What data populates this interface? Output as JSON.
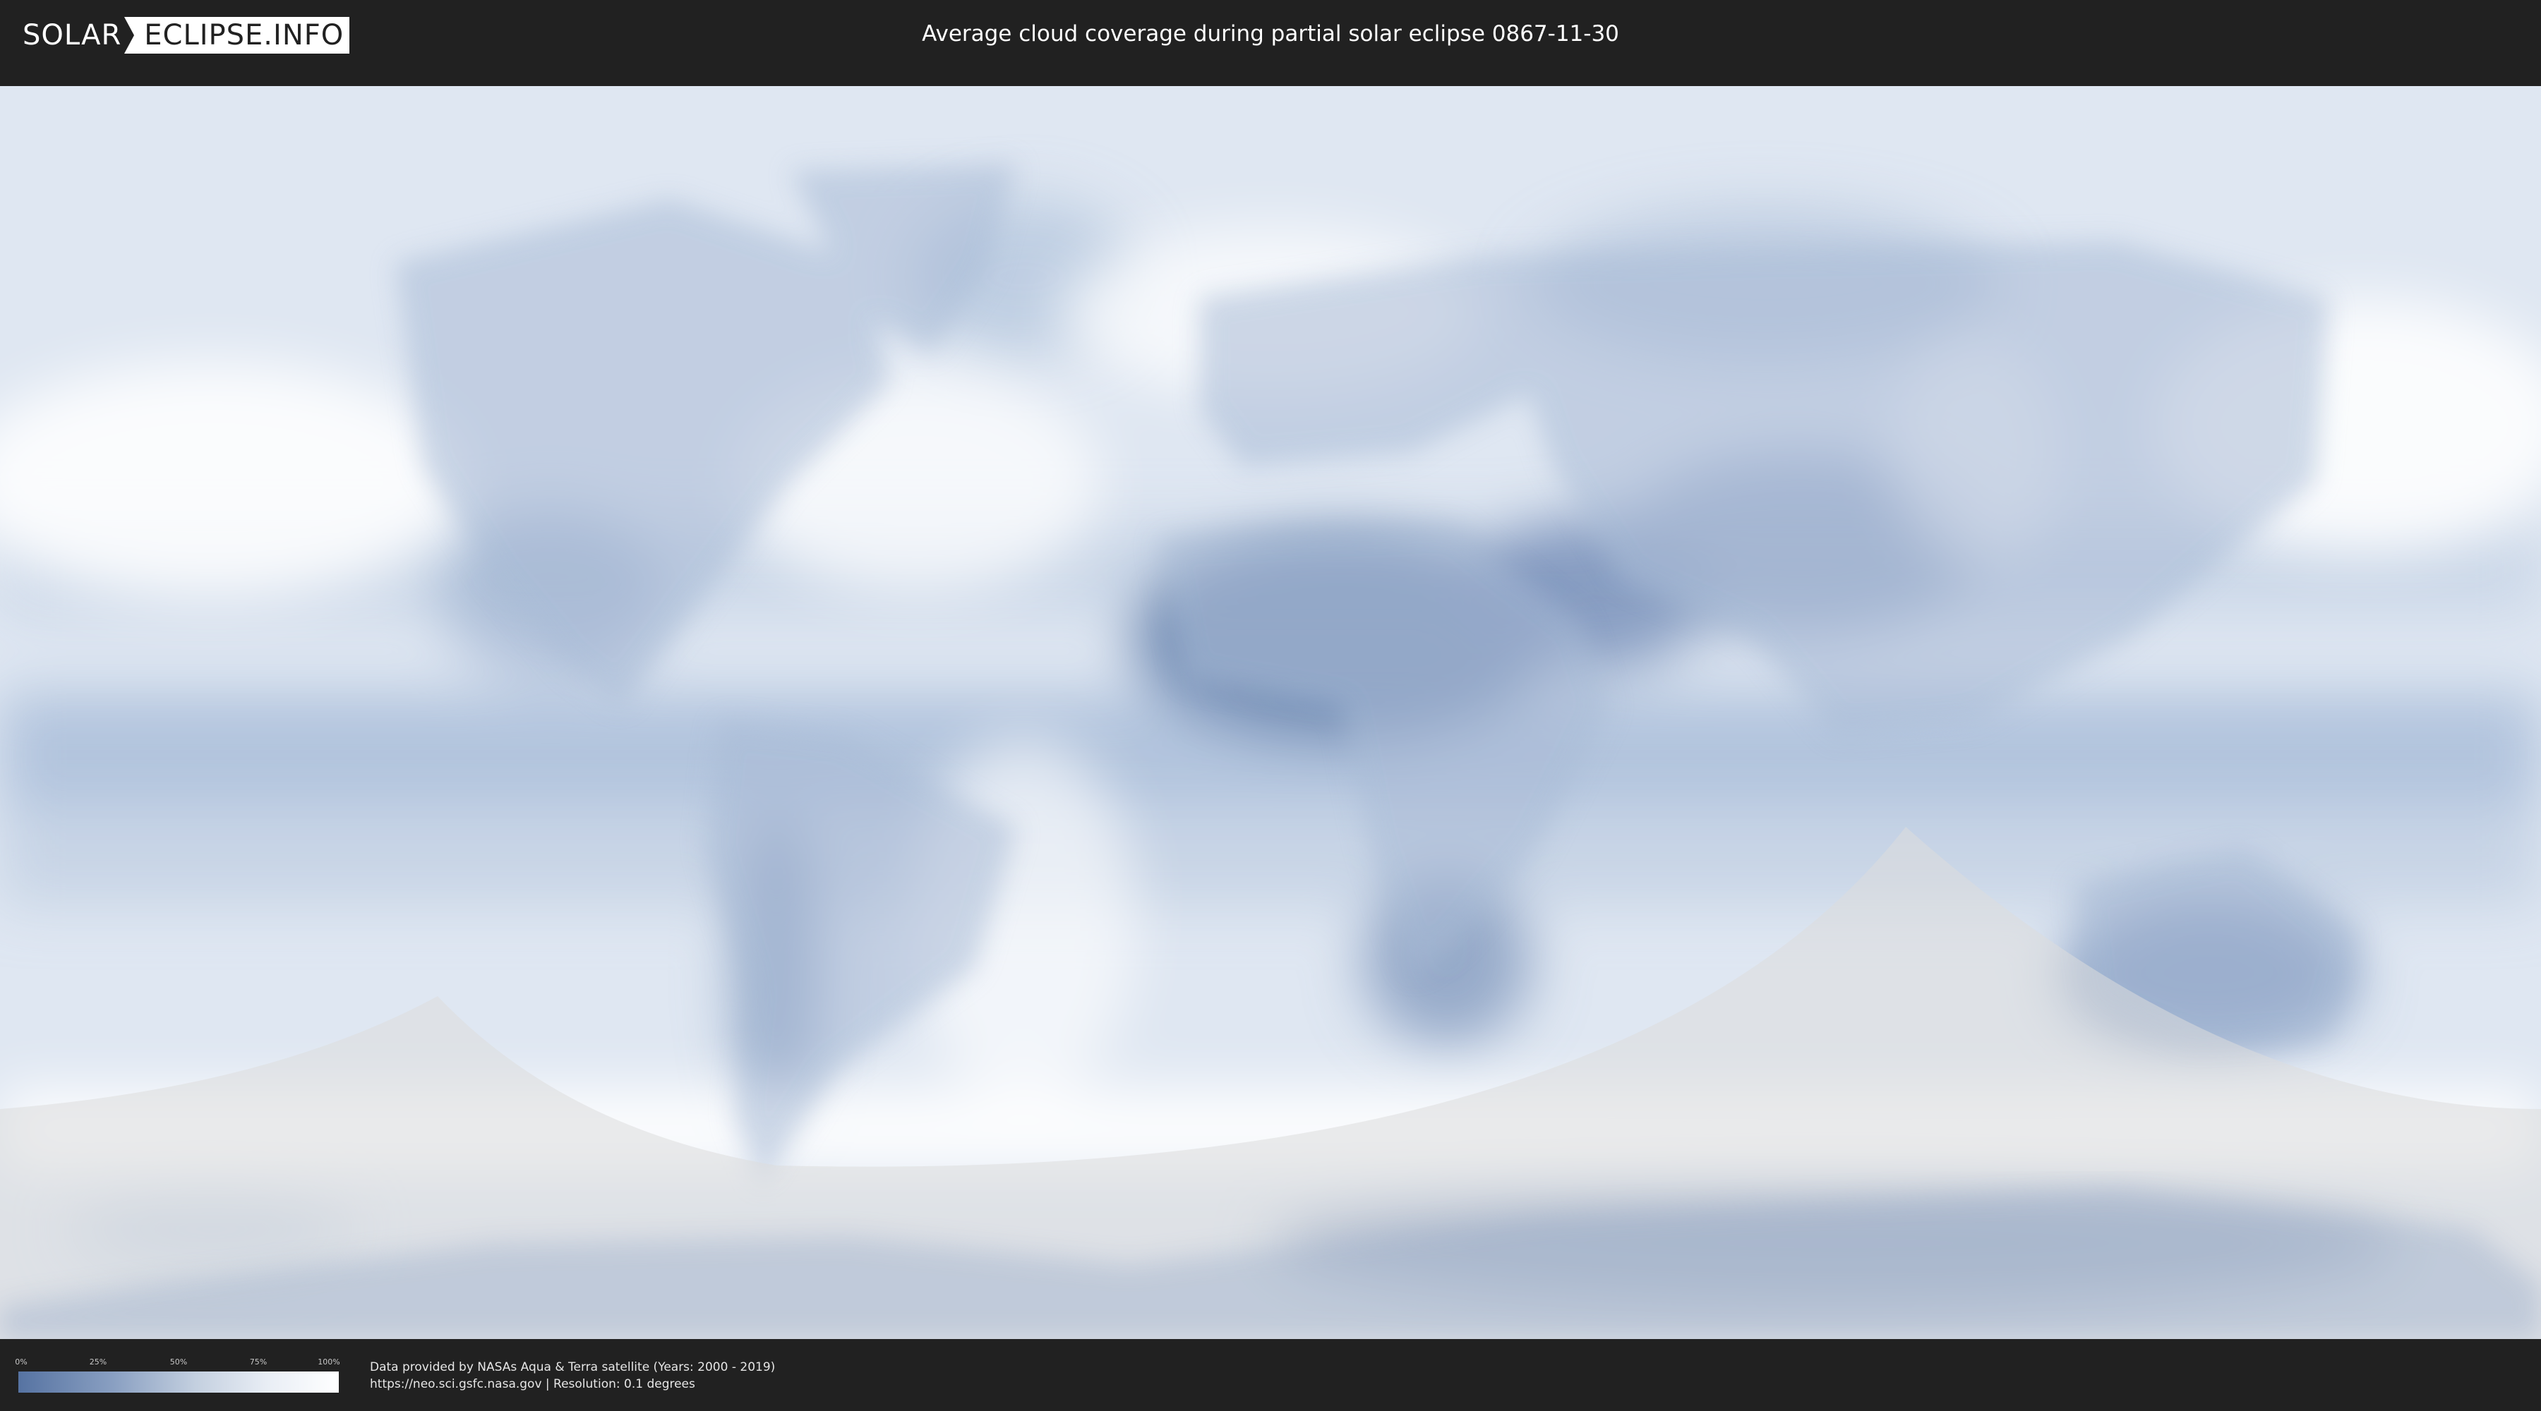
{
  "header": {
    "logo_solar": "SOLAR",
    "logo_eclipse": "ECLIPSE.INFO",
    "title": "Average cloud coverage during partial solar eclipse 0867-11-30"
  },
  "legend": {
    "ticks": [
      "0%",
      "25%",
      "50%",
      "75%",
      "100%"
    ],
    "colors": {
      "low": "#5673a2",
      "high": "#ffffff"
    }
  },
  "credits": {
    "line1": "Data provided by NASAs Aqua & Terra satellite (Years: 2000 - 2019)",
    "line2": "https://neo.sci.gsfc.nasa.gov | Resolution: 0.1 degrees"
  },
  "map": {
    "ocean_color": "#c6d5e8",
    "cloud_color": "#ffffff",
    "clear_color": "#6f89b3",
    "shadow_color": "#dcdcdc"
  }
}
